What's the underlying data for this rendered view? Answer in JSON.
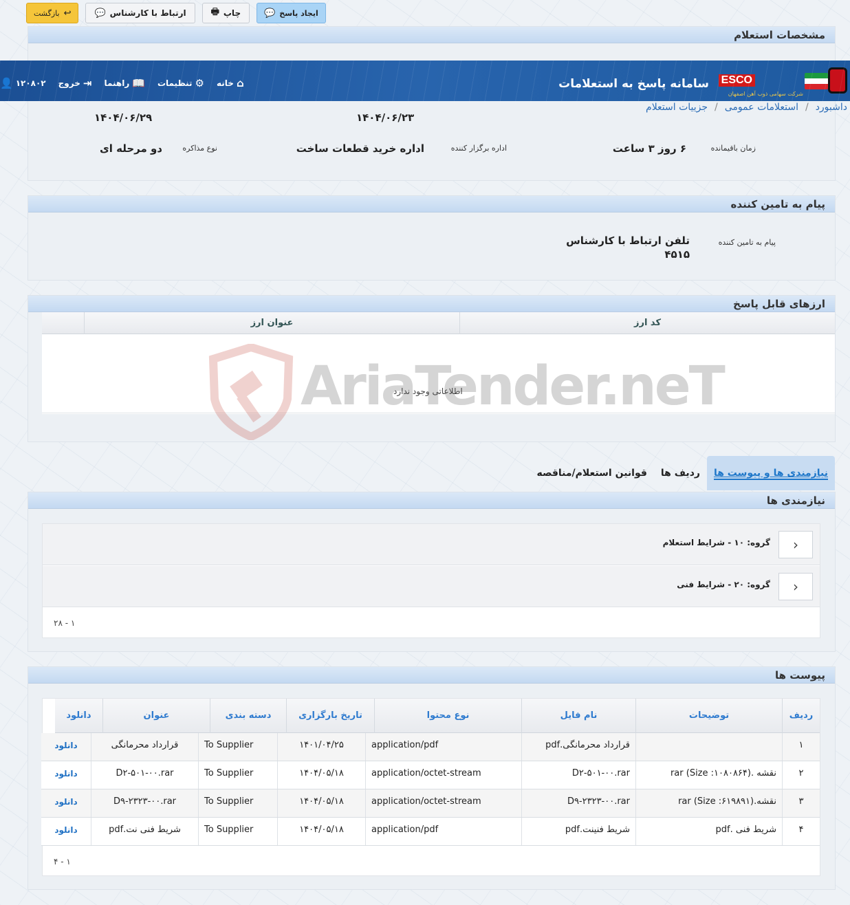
{
  "toolbar": {
    "back_label": "بازگشت",
    "contact_label": "ارتباط با کارشناس",
    "print_label": "چاپ",
    "reply_label": "ایجاد پاسخ"
  },
  "header": {
    "title": "سامانه پاسخ به استعلامات",
    "brand": "ESCO",
    "brand_sub": "شرکت سهامی ذوب آهن اصفهان",
    "nav": {
      "home": "خانه",
      "settings": "تنظیمات",
      "guide": "راهنما",
      "logout": "خروج",
      "user_id": "۱۲۰۸۰۲"
    }
  },
  "breadcrumb": [
    "داشبورد",
    "استعلامات عمومی",
    "جزییات استعلام"
  ],
  "specs": {
    "title": "مشخصات استعلام",
    "date_1": "۱۴۰۴/۰۶/۲۹",
    "date_2": "۱۴۰۴/۰۶/۲۳",
    "remaining_label": "زمان باقیمانده",
    "remaining_value": "۶ روز ۳ ساعت",
    "organizer_label": "اداره برگزار کننده",
    "organizer_value": "اداره خرید قطعات ساخت",
    "negotiation_label": "نوع مذاکره",
    "negotiation_value": "دو مرحله ای"
  },
  "supplier_message": {
    "title": "پیام به تامین کننده",
    "label": "پیام به تامین کننده",
    "value_line1": "تلفن ارتباط با کارشناس",
    "value_line2": "۴۵۱۵"
  },
  "currencies": {
    "title": "ارزهای قابل پاسخ",
    "columns": [
      "کد ارز",
      "عنوان ارز"
    ],
    "empty_text": "اطلاعاتی وجود ندارد"
  },
  "tabs": [
    "نیازمندی ها و پیوست ها",
    "ردیف ها",
    "قوانین استعلام/مناقصه"
  ],
  "requirements": {
    "title": "نیازمندی ها",
    "groups": [
      "گروه: ۱۰ - شرایط استعلام",
      "گروه: ۲۰ - شرایط فنی"
    ],
    "pager": "۱ - ۲۸"
  },
  "attachments": {
    "title": "پیوست ها",
    "columns": [
      "ردیف",
      "توضیحات",
      "نام فایل",
      "نوع محتوا",
      "تاریخ بارگزاری",
      "دسته بندی",
      "عنوان",
      "دانلود"
    ],
    "rows": [
      [
        "۱",
        "",
        "قرارداد محرمانگی.pdf",
        "application/pdf",
        "۱۴۰۱/۰۴/۲۵",
        "To Supplier",
        "قرارداد محرمانگی",
        "دانلود"
      ],
      [
        "۲",
        "نقشه .rar (Size :۱۰۸۰۸۶۴)",
        "D۲-۵۰۱-۰۰.rar",
        "application/octet-stream",
        "۱۴۰۴/۰۵/۱۸",
        "To Supplier",
        "D۲-۵۰۱-۰۰.rar",
        "دانلود"
      ],
      [
        "۳",
        "نقشه.rar (Size :۶۱۹۸۹۱)",
        "D۹-۲۳۲۳-۰۰.rar",
        "application/octet-stream",
        "۱۴۰۴/۰۵/۱۸",
        "To Supplier",
        "D۹-۲۳۲۳-۰۰.rar",
        "دانلود"
      ],
      [
        "۴",
        "شریط فنی .pdf",
        "شریط فنینت.pdf",
        "application/pdf",
        "۱۴۰۴/۰۵/۱۸",
        "To Supplier",
        "شریط فنی نت.pdf",
        "دانلود"
      ]
    ],
    "pager": "۱ - ۴"
  },
  "watermark": "AriaTender.neT",
  "colors": {
    "accent": "#2b6cb6",
    "header": "#2864ad",
    "reply_button": "#a9d4f6",
    "back_button": "#f5c53a"
  }
}
